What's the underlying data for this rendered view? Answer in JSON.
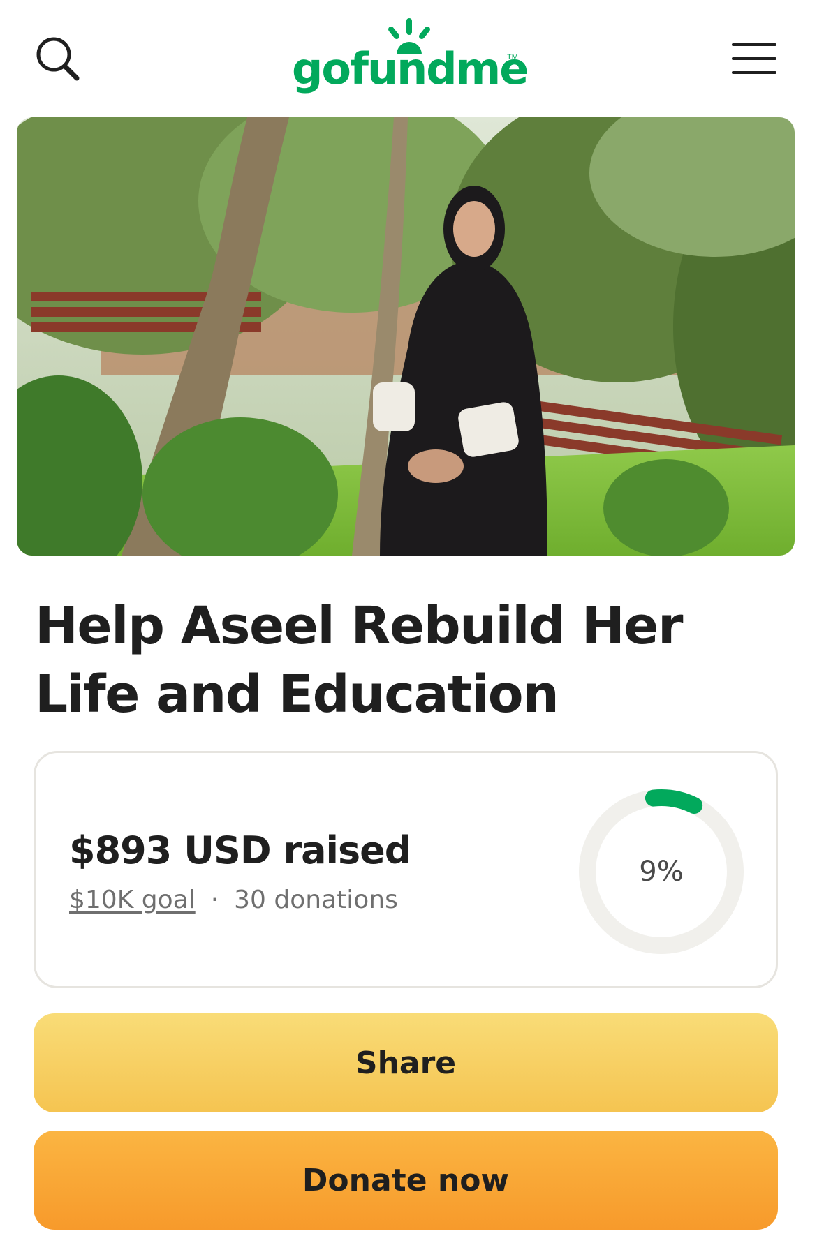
{
  "header": {
    "logo_text": "gofundme",
    "logo_tm": "TM",
    "search_icon": "search-icon",
    "menu_icon": "hamburger-menu-icon"
  },
  "campaign": {
    "title": "Help Aseel Rebuild Her Life and Education",
    "raised": "$893 USD raised",
    "goal": "$10K goal",
    "separator": "·",
    "donations": "30 donations",
    "percent_label": "9%",
    "progress_fraction": 0.09
  },
  "actions": {
    "share_label": "Share",
    "donate_label": "Donate now"
  },
  "colors": {
    "brand_green": "#02a95c",
    "share_yellow": "#f6cc5e",
    "donate_orange": "#f8a533",
    "ring_track": "#f1f0ec"
  }
}
